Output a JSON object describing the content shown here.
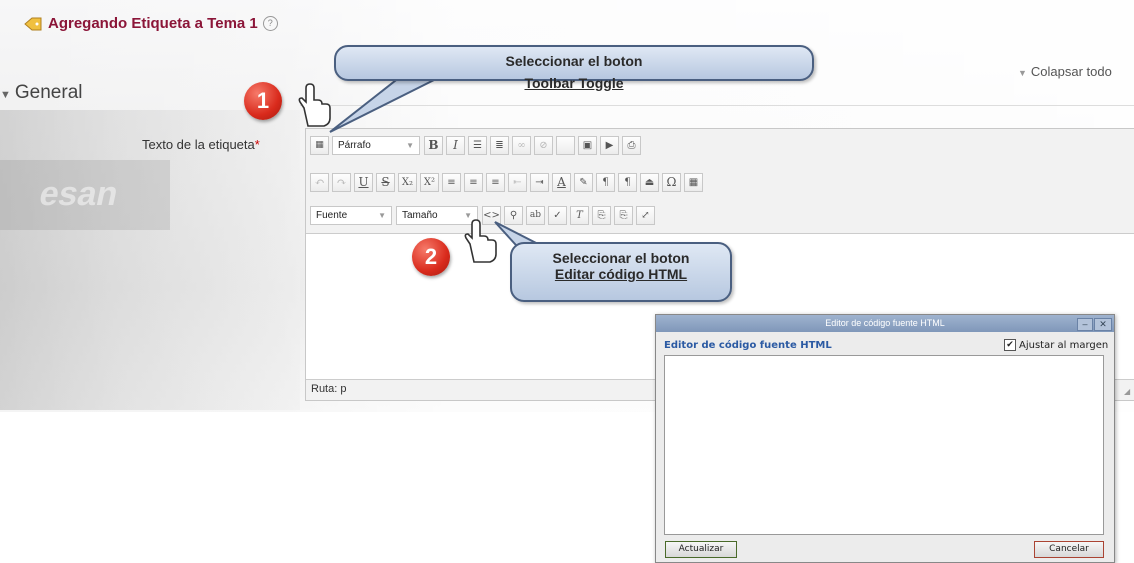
{
  "header": {
    "title": "Agregando Etiqueta a Tema 1",
    "help": "?",
    "collapse_all": "Colapsar todo"
  },
  "section": {
    "general": "General",
    "field_label": "Texto de la etiqueta",
    "required_marker": "*"
  },
  "editor": {
    "format_select": "Párrafo",
    "font_select": "Fuente",
    "size_select": "Tamaño",
    "status_path": "Ruta: p"
  },
  "callouts": {
    "step1_number": "1",
    "step1_prefix": "Seleccionar el boton ",
    "step1_target": "Toolbar Toggle",
    "step2_number": "2",
    "step2_line1": "Seleccionar el boton",
    "step2_target": "Editar código HTML"
  },
  "dialog": {
    "window_title": "Editor de código fuente HTML",
    "heading": "Editor de código fuente HTML",
    "wrap_label": "Ajustar al margen",
    "wrap_checked": true,
    "update_button": "Actualizar",
    "cancel_button": "Cancelar"
  },
  "colors": {
    "title": "#8b1538",
    "dialog_heading": "#2b5aa3",
    "badge": "#d92a1c",
    "callout_border": "#4a5f80"
  }
}
